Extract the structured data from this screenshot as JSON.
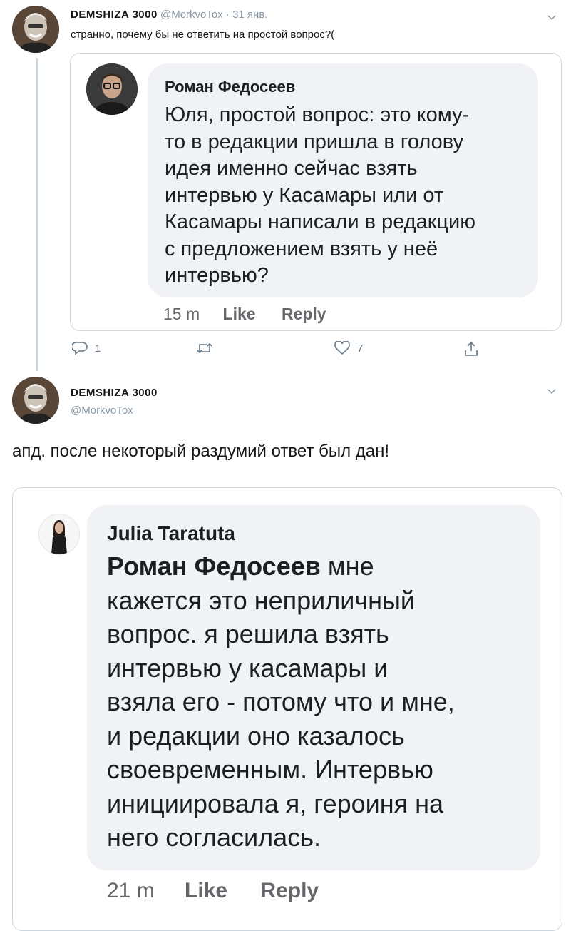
{
  "tweet1": {
    "author_name": "DEMSHIZA 3000",
    "handle": "@MorkvoTox",
    "separator": "·",
    "date": "31 янв.",
    "text": "странно, почему бы не ответить на простой вопрос?(",
    "quoted_comment": {
      "author": "Роман Федосеев",
      "text_lines": [
        "Юля, простой вопрос: это кому-",
        "то в редакции пришла в голову",
        "идея именно сейчас взять",
        "интервью у Касамары или от",
        "Касамары написали в редакцию",
        "с предложением взять у неё",
        "интервью?"
      ],
      "time": "15 m",
      "like_label": "Like",
      "reply_label": "Reply"
    },
    "actions": {
      "reply_count": "1",
      "retweet_count": "",
      "like_count": "7"
    }
  },
  "tweet2": {
    "author_name": "DEMSHIZA 3000",
    "handle": "@MorkvoTox",
    "text": "апд. после некоторый раздумий ответ был дан!",
    "image_comment": {
      "author": "Julia Taratuta",
      "mention": "Роман Федосеев",
      "text_first_rest": " мне",
      "text_lines": [
        "кажется это неприличный",
        "вопрос.  я решила взять",
        "интервью у касамары и",
        "взяла его - потому что и мне,",
        "и редакции оно казалось",
        "своевременным. Интервью",
        "инициировала я, героиня на",
        "него согласилась."
      ],
      "time": "21 m",
      "like_label": "Like",
      "reply_label": "Reply"
    }
  },
  "icons": {
    "reply": "reply-icon",
    "retweet": "retweet-icon",
    "like": "heart-icon",
    "share": "share-icon",
    "more": "chevron-down-icon"
  },
  "colors": {
    "muted": "#8a98a6",
    "border": "#ccd6dd",
    "bubble": "#f0f2f5",
    "text": "#14171a"
  }
}
